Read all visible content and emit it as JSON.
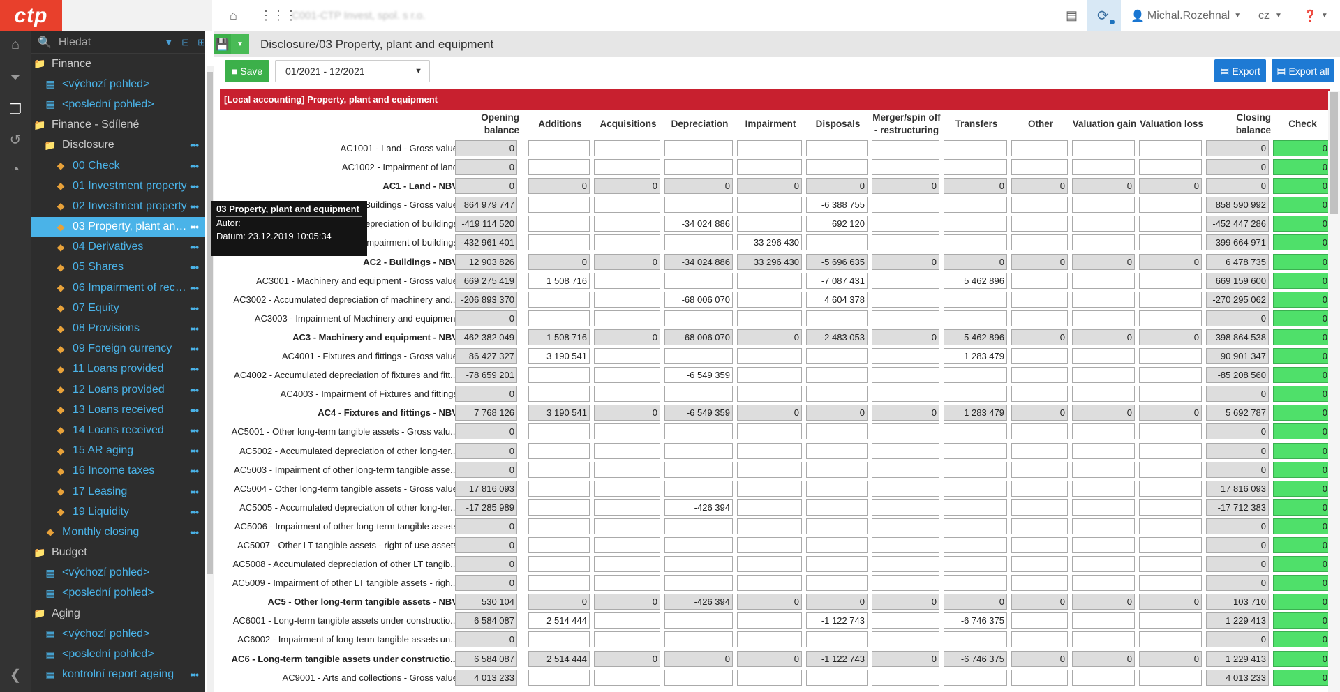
{
  "app": {
    "logo": "ctp",
    "company": "C001-CTP Invest, spol. s r.o.",
    "user": "Michal.Rozehnal",
    "language": "cz",
    "home_icon": "home-icon",
    "apps_icon": "apps-grid-icon",
    "help_icon": "question-circle-icon"
  },
  "sidebar": {
    "search_placeholder": "Hledat",
    "items": [
      {
        "label": "Finance",
        "icon": "folder-icon",
        "level": 0,
        "kind": "folder"
      },
      {
        "label": "<výchozí pohled>",
        "icon": "table-icon",
        "level": 1,
        "kind": "link"
      },
      {
        "label": "<poslední pohled>",
        "icon": "table-icon",
        "level": 1,
        "kind": "link"
      },
      {
        "label": "Finance - Sdílené",
        "icon": "folder-icon",
        "level": 0,
        "kind": "folder"
      },
      {
        "label": "Disclosure",
        "icon": "folder-icon",
        "level": 1,
        "kind": "folder",
        "dots": true
      },
      {
        "label": "00 Check",
        "icon": "form-icon",
        "level": 2,
        "kind": "link",
        "dots": true
      },
      {
        "label": "01 Investment property",
        "icon": "form-icon",
        "level": 2,
        "kind": "link",
        "dots": true
      },
      {
        "label": "02 Investment property",
        "icon": "form-icon",
        "level": 2,
        "kind": "link",
        "dots": true
      },
      {
        "label": "03 Property, plant and equipment",
        "icon": "form-icon",
        "level": 2,
        "kind": "link",
        "dots": true,
        "selected": true
      },
      {
        "label": "04 Derivatives",
        "icon": "form-icon",
        "level": 2,
        "kind": "link",
        "dots": true
      },
      {
        "label": "05 Shares",
        "icon": "form-icon",
        "level": 2,
        "kind": "link",
        "dots": true
      },
      {
        "label": "06 Impairment of receivables",
        "icon": "form-icon",
        "level": 2,
        "kind": "link",
        "dots": true
      },
      {
        "label": "07 Equity",
        "icon": "form-icon",
        "level": 2,
        "kind": "link",
        "dots": true
      },
      {
        "label": "08 Provisions",
        "icon": "form-icon",
        "level": 2,
        "kind": "link",
        "dots": true
      },
      {
        "label": "09 Foreign currency",
        "icon": "form-icon",
        "level": 2,
        "kind": "link",
        "dots": true
      },
      {
        "label": "11 Loans provided",
        "icon": "form-icon",
        "level": 2,
        "kind": "link",
        "dots": true
      },
      {
        "label": "12 Loans provided",
        "icon": "form-icon",
        "level": 2,
        "kind": "link",
        "dots": true
      },
      {
        "label": "13 Loans received",
        "icon": "form-icon",
        "level": 2,
        "kind": "link",
        "dots": true
      },
      {
        "label": "14 Loans received",
        "icon": "form-icon",
        "level": 2,
        "kind": "link",
        "dots": true
      },
      {
        "label": "15 AR aging",
        "icon": "form-icon",
        "level": 2,
        "kind": "link",
        "dots": true
      },
      {
        "label": "16 Income taxes",
        "icon": "form-icon",
        "level": 2,
        "kind": "link",
        "dots": true
      },
      {
        "label": "17 Leasing",
        "icon": "form-icon",
        "level": 2,
        "kind": "link",
        "dots": true
      },
      {
        "label": "19 Liquidity",
        "icon": "form-icon",
        "level": 2,
        "kind": "link",
        "dots": true
      },
      {
        "label": "Monthly closing",
        "icon": "form-icon",
        "level": 1,
        "kind": "link",
        "dots": true
      },
      {
        "label": "Budget",
        "icon": "folder-icon",
        "level": 0,
        "kind": "folder"
      },
      {
        "label": "<výchozí pohled>",
        "icon": "table-icon",
        "level": 1,
        "kind": "link"
      },
      {
        "label": "<poslední pohled>",
        "icon": "table-icon",
        "level": 1,
        "kind": "link"
      },
      {
        "label": "Aging",
        "icon": "folder-icon",
        "level": 0,
        "kind": "folder"
      },
      {
        "label": "<výchozí pohled>",
        "icon": "table-icon",
        "level": 1,
        "kind": "link"
      },
      {
        "label": "<poslední pohled>",
        "icon": "table-icon",
        "level": 1,
        "kind": "link"
      },
      {
        "label": "kontrolní report ageing",
        "icon": "table-icon",
        "level": 1,
        "kind": "link",
        "dots": true
      }
    ]
  },
  "tooltip": {
    "title": "03 Property, plant and equipment",
    "author": "Autor:",
    "date": "Datum: 23.12.2019 10:05:34"
  },
  "main": {
    "breadcrumb": "Disclosure/03 Property, plant and equipment",
    "save_label": "Save",
    "period": "01/2021 - 12/2021",
    "export_label": "Export",
    "export_all_label": "Export all",
    "section_title": "[Local accounting] Property, plant and equipment",
    "columns": [
      "Opening balance",
      "Additions",
      "Acquisitions",
      "Depreciation",
      "Impairment",
      "Disposals",
      "Merger/spin off - restructuring",
      "Transfers",
      "Other",
      "Valuation gain",
      "Valuation loss",
      "Closing balance",
      "Check"
    ],
    "rows": [
      {
        "label": "AC1001 - Land - Gross value",
        "bold": false,
        "values": [
          "0",
          "",
          "",
          "",
          "",
          "",
          "",
          "",
          "",
          "",
          "",
          "0",
          "0"
        ]
      },
      {
        "label": "AC1002 - Impairment of land",
        "bold": false,
        "values": [
          "0",
          "",
          "",
          "",
          "",
          "",
          "",
          "",
          "",
          "",
          "",
          "0",
          "0"
        ]
      },
      {
        "label": "AC1 - Land - NBV",
        "bold": true,
        "values": [
          "0",
          "0",
          "0",
          "0",
          "0",
          "0",
          "0",
          "0",
          "0",
          "0",
          "0",
          "0",
          "0"
        ]
      },
      {
        "label": "AC2001 - Buildings - Gross value",
        "bold": false,
        "values": [
          "864 979 747",
          "",
          "",
          "",
          "",
          "-6 388 755",
          "",
          "",
          "",
          "",
          "",
          "858 590 992",
          "0"
        ]
      },
      {
        "label": "AC2002 - Accumulated depreciation of buildings",
        "bold": false,
        "values": [
          "-419 114 520",
          "",
          "",
          "-34 024 886",
          "",
          "692 120",
          "",
          "",
          "",
          "",
          "",
          "-452 447 286",
          "0"
        ]
      },
      {
        "label": "AC2003 - Impairment of buildings",
        "bold": false,
        "values": [
          "-432 961 401",
          "",
          "",
          "",
          "33 296 430",
          "",
          "",
          "",
          "",
          "",
          "",
          "-399 664 971",
          "0"
        ]
      },
      {
        "label": "AC2 - Buildings - NBV",
        "bold": true,
        "values": [
          "12 903 826",
          "0",
          "0",
          "-34 024 886",
          "33 296 430",
          "-5 696 635",
          "0",
          "0",
          "0",
          "0",
          "0",
          "6 478 735",
          "0"
        ]
      },
      {
        "label": "AC3001 - Machinery and equipment - Gross value",
        "bold": false,
        "values": [
          "669 275 419",
          "1 508 716",
          "",
          "",
          "",
          "-7 087 431",
          "",
          "5 462 896",
          "",
          "",
          "",
          "669 159 600",
          "0"
        ]
      },
      {
        "label": "AC3002 - Accumulated depreciation of machinery and...",
        "bold": false,
        "values": [
          "-206 893 370",
          "",
          "",
          "-68 006 070",
          "",
          "4 604 378",
          "",
          "",
          "",
          "",
          "",
          "-270 295 062",
          "0"
        ]
      },
      {
        "label": "AC3003 - Impairment of Machinery and equipment",
        "bold": false,
        "values": [
          "0",
          "",
          "",
          "",
          "",
          "",
          "",
          "",
          "",
          "",
          "",
          "0",
          "0"
        ]
      },
      {
        "label": "AC3 - Machinery and equipment - NBV",
        "bold": true,
        "values": [
          "462 382 049",
          "1 508 716",
          "0",
          "-68 006 070",
          "0",
          "-2 483 053",
          "0",
          "5 462 896",
          "0",
          "0",
          "0",
          "398 864 538",
          "0"
        ]
      },
      {
        "label": "AC4001 - Fixtures and fittings - Gross value",
        "bold": false,
        "values": [
          "86 427 327",
          "3 190 541",
          "",
          "",
          "",
          "",
          "",
          "1 283 479",
          "",
          "",
          "",
          "90 901 347",
          "0"
        ]
      },
      {
        "label": "AC4002 - Accumulated depreciation of fixtures and fitt...",
        "bold": false,
        "values": [
          "-78 659 201",
          "",
          "",
          "-6 549 359",
          "",
          "",
          "",
          "",
          "",
          "",
          "",
          "-85 208 560",
          "0"
        ]
      },
      {
        "label": "AC4003 - Impairment of Fixtures and fittings",
        "bold": false,
        "values": [
          "0",
          "",
          "",
          "",
          "",
          "",
          "",
          "",
          "",
          "",
          "",
          "0",
          "0"
        ]
      },
      {
        "label": "AC4 - Fixtures and fittings - NBV",
        "bold": true,
        "values": [
          "7 768 126",
          "3 190 541",
          "0",
          "-6 549 359",
          "0",
          "0",
          "0",
          "1 283 479",
          "0",
          "0",
          "0",
          "5 692 787",
          "0"
        ]
      },
      {
        "label": "AC5001 - Other long-term tangible assets - Gross valu...",
        "bold": false,
        "values": [
          "0",
          "",
          "",
          "",
          "",
          "",
          "",
          "",
          "",
          "",
          "",
          "0",
          "0"
        ]
      },
      {
        "label": "AC5002 - Accumulated depreciation of other long-ter...",
        "bold": false,
        "values": [
          "0",
          "",
          "",
          "",
          "",
          "",
          "",
          "",
          "",
          "",
          "",
          "0",
          "0"
        ]
      },
      {
        "label": "AC5003 - Impairment of other long-term tangible asse...",
        "bold": false,
        "values": [
          "0",
          "",
          "",
          "",
          "",
          "",
          "",
          "",
          "",
          "",
          "",
          "0",
          "0"
        ]
      },
      {
        "label": "AC5004 - Other long-term tangible assets - Gross value",
        "bold": false,
        "values": [
          "17 816 093",
          "",
          "",
          "",
          "",
          "",
          "",
          "",
          "",
          "",
          "",
          "17 816 093",
          "0"
        ]
      },
      {
        "label": "AC5005 - Accumulated depreciation of other long-ter...",
        "bold": false,
        "values": [
          "-17 285 989",
          "",
          "",
          "-426 394",
          "",
          "",
          "",
          "",
          "",
          "",
          "",
          "-17 712 383",
          "0"
        ]
      },
      {
        "label": "AC5006 - Impairment of other long-term tangible assets",
        "bold": false,
        "values": [
          "0",
          "",
          "",
          "",
          "",
          "",
          "",
          "",
          "",
          "",
          "",
          "0",
          "0"
        ]
      },
      {
        "label": "AC5007 - Other LT tangible assets - right of use assets",
        "bold": false,
        "values": [
          "0",
          "",
          "",
          "",
          "",
          "",
          "",
          "",
          "",
          "",
          "",
          "0",
          "0"
        ]
      },
      {
        "label": "AC5008 - Accumulated depreciation of other LT tangib...",
        "bold": false,
        "values": [
          "0",
          "",
          "",
          "",
          "",
          "",
          "",
          "",
          "",
          "",
          "",
          "0",
          "0"
        ]
      },
      {
        "label": "AC5009 - Impairment of other LT tangible assets - righ...",
        "bold": false,
        "values": [
          "0",
          "",
          "",
          "",
          "",
          "",
          "",
          "",
          "",
          "",
          "",
          "0",
          "0"
        ]
      },
      {
        "label": "AC5 - Other long-term tangible assets - NBV",
        "bold": true,
        "values": [
          "530 104",
          "0",
          "0",
          "-426 394",
          "0",
          "0",
          "0",
          "0",
          "0",
          "0",
          "0",
          "103 710",
          "0"
        ]
      },
      {
        "label": "AC6001 - Long-term tangible assets under constructio...",
        "bold": false,
        "values": [
          "6 584 087",
          "2 514 444",
          "",
          "",
          "",
          "-1 122 743",
          "",
          "-6 746 375",
          "",
          "",
          "",
          "1 229 413",
          "0"
        ]
      },
      {
        "label": "AC6002 - Impairment of long-term tangible assets un...",
        "bold": false,
        "values": [
          "0",
          "",
          "",
          "",
          "",
          "",
          "",
          "",
          "",
          "",
          "",
          "0",
          "0"
        ]
      },
      {
        "label": "AC6 - Long-term tangible assets under constructio...",
        "bold": true,
        "values": [
          "6 584 087",
          "2 514 444",
          "0",
          "0",
          "0",
          "-1 122 743",
          "0",
          "-6 746 375",
          "0",
          "0",
          "0",
          "1 229 413",
          "0"
        ]
      },
      {
        "label": "AC9001 - Arts and collections - Gross value",
        "bold": false,
        "values": [
          "4 013 233",
          "",
          "",
          "",
          "",
          "",
          "",
          "",
          "",
          "",
          "",
          "4 013 233",
          "0"
        ]
      }
    ]
  }
}
